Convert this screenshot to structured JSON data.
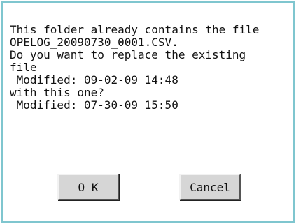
{
  "dialog": {
    "message_lines": [
      "This folder already contains the file",
      "OPELOG_20090730_0001.CSV.",
      "Do you want to replace the existing",
      "file",
      " Modified: 09-02-09 14:48",
      "with this one?",
      " Modified: 07-30-09 15:50"
    ],
    "ok_label": "O K",
    "cancel_label": "Cancel"
  },
  "colors": {
    "border": "#7fc6cf",
    "button_face": "#d6d6d6"
  }
}
